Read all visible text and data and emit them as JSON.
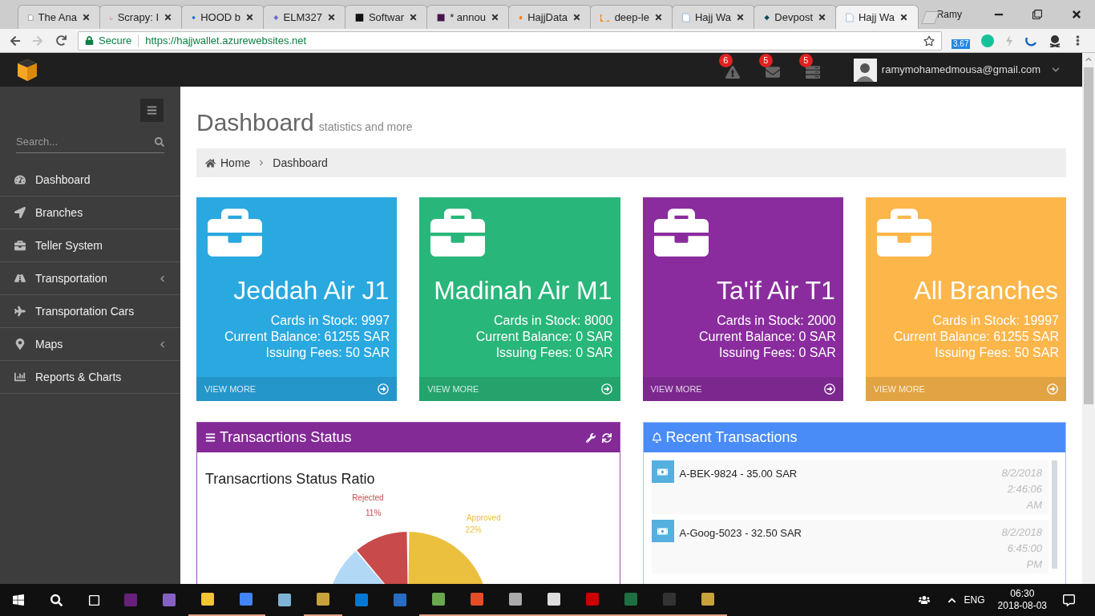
{
  "browser": {
    "tabs": [
      {
        "title": "The Ana",
        "selected": false
      },
      {
        "title": "Scrapy: I",
        "selected": false
      },
      {
        "title": "HOOD b",
        "selected": false
      },
      {
        "title": "ELM327",
        "selected": false
      },
      {
        "title": "Softwar",
        "selected": false
      },
      {
        "title": "* annou",
        "selected": false
      },
      {
        "title": "HajjData",
        "selected": false
      },
      {
        "title": "deep-le",
        "selected": false
      },
      {
        "title": "Hajj Wa",
        "selected": false
      },
      {
        "title": "Devpost",
        "selected": false
      },
      {
        "title": "Hajj Wa",
        "selected": true
      }
    ],
    "profile": "Ramy",
    "secure_label": "Secure",
    "url": "https://hajjwallet.azurewebsites.net",
    "extension_badge": "3.67"
  },
  "header": {
    "notifications": [
      {
        "count": "6"
      },
      {
        "count": "5"
      },
      {
        "count": "5"
      }
    ],
    "user_email": "ramymohamedmousa@gmail.com"
  },
  "sidebar": {
    "search": {
      "placeholder": "Search..."
    },
    "items": [
      {
        "label": "Dashboard",
        "has_submenu": false
      },
      {
        "label": "Branches",
        "has_submenu": false
      },
      {
        "label": "Teller System",
        "has_submenu": false
      },
      {
        "label": "Transportation",
        "has_submenu": true
      },
      {
        "label": "Transportation Cars",
        "has_submenu": false
      },
      {
        "label": "Maps",
        "has_submenu": true
      },
      {
        "label": "Reports & Charts",
        "has_submenu": false
      }
    ]
  },
  "page": {
    "title": "Dashboard",
    "subtitle": "statistics and more",
    "breadcrumb": [
      "Home",
      "Dashboard"
    ]
  },
  "cards": [
    {
      "title": "Jeddah Air J1",
      "lines": [
        "Cards in Stock: 9997",
        "Current Balance: 61255 SAR",
        "Issuing Fees: 50 SAR"
      ],
      "link": "VIEW MORE",
      "color": "#2aa8e0"
    },
    {
      "title": "Madinah Air M1",
      "lines": [
        "Cards in Stock: 8000",
        "Current Balance: 0 SAR",
        "Issuing Fees: 0 SAR"
      ],
      "link": "VIEW MORE",
      "color": "#29b67a"
    },
    {
      "title": "Ta'if Air T1",
      "lines": [
        "Cards in Stock: 2000",
        "Current Balance: 0 SAR",
        "Issuing Fees: 0 SAR"
      ],
      "link": "VIEW MORE",
      "color": "#8a2c9e"
    },
    {
      "title": "All Branches",
      "lines": [
        "Cards in Stock: 19997",
        "Current Balance: 61255 SAR",
        "Issuing Fees: 50 SAR"
      ],
      "link": "VIEW MORE",
      "color": "#fcb64a"
    }
  ],
  "status_panel": {
    "title": "Transacrtions Status",
    "chart_title": "Transacrtions Status Ratio",
    "slice_labels": [
      {
        "name": "Rejected",
        "value": "11%",
        "color": "#c94a4a"
      },
      {
        "name": "Approved",
        "value": "22%",
        "color": "#ebc03e"
      }
    ]
  },
  "transactions_panel": {
    "title": "Recent Transactions",
    "items": [
      {
        "label": "A-BEK-9824 - 35.00 SAR",
        "date": "8/2/2018",
        "time": "2:46:06",
        "meridiem": "AM"
      },
      {
        "label": "A-Goog-5023 - 32.50 SAR",
        "date": "8/2/2018",
        "time": "6:45:00",
        "meridiem": "PM"
      }
    ]
  },
  "taskbar": {
    "apps": [
      {
        "running": false
      },
      {
        "running": false
      },
      {
        "running": true
      },
      {
        "running": true
      },
      {
        "running": false
      },
      {
        "running": true
      },
      {
        "running": false
      },
      {
        "running": false
      },
      {
        "running": true
      },
      {
        "running": true
      },
      {
        "running": true
      },
      {
        "running": true
      },
      {
        "running": true
      },
      {
        "running": true
      },
      {
        "running": true
      },
      {
        "running": true
      }
    ],
    "language": "ENG",
    "time": "06:30",
    "date": "2018-08-03"
  }
}
